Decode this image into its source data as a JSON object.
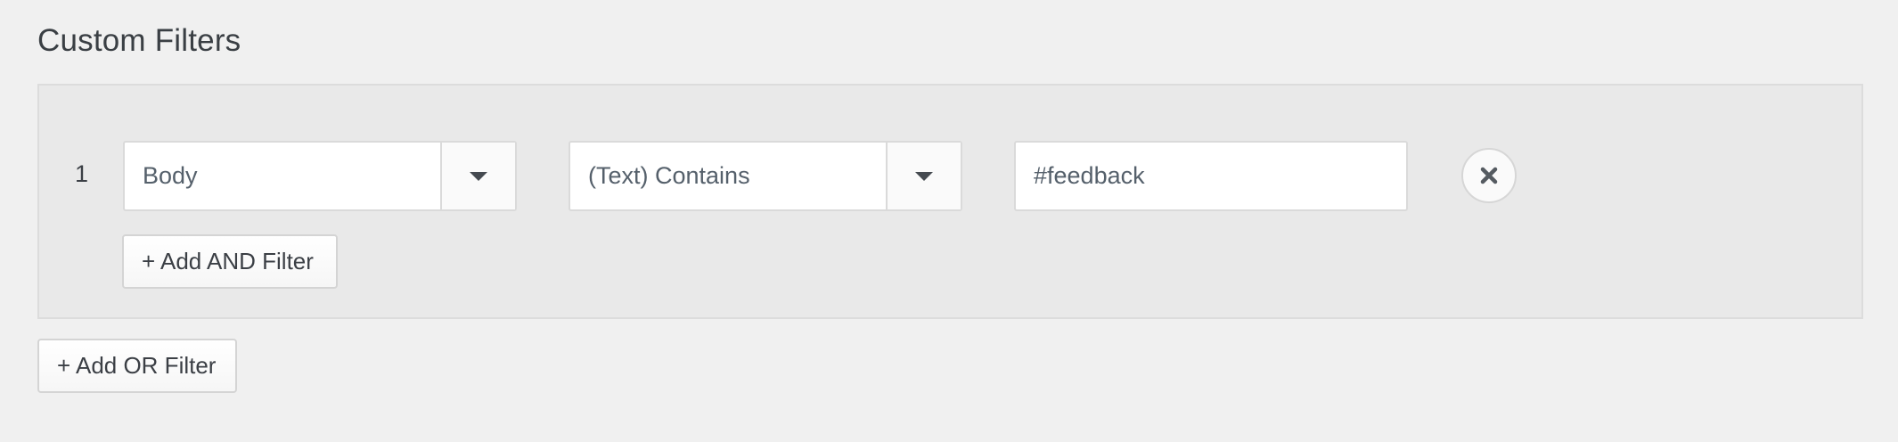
{
  "section": {
    "title": "Custom Filters"
  },
  "filter_groups": [
    {
      "index": "1",
      "field": {
        "selected": "Body"
      },
      "operator": {
        "selected": "(Text) Contains"
      },
      "value": "#feedback",
      "add_and_label": "+ Add AND Filter"
    }
  ],
  "add_or_label": "+ Add OR Filter",
  "icons": {
    "remove": "close-icon",
    "dropdown": "chevron-down-icon"
  },
  "colors": {
    "background": "#f0f0f0",
    "group_background": "#e9e9e9",
    "text": "#3b3f45"
  }
}
